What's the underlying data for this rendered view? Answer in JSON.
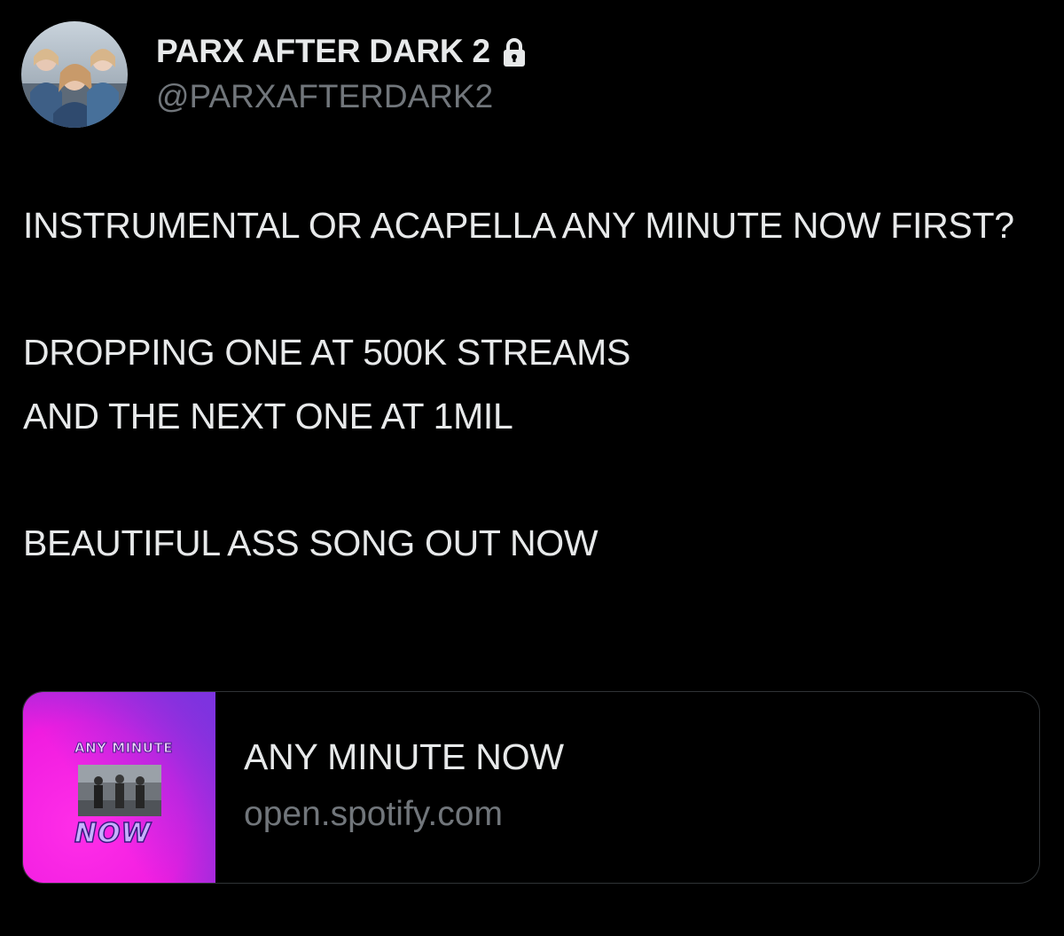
{
  "author": {
    "display_name": "PARX AFTER DARK 2",
    "handle": "@PARXAFTERDARK2",
    "protected_icon": "lock-icon",
    "avatar_icon": "profile-photo"
  },
  "tweet": {
    "paragraphs": [
      "INSTRUMENTAL OR ACAPELLA ANY MINUTE NOW FIRST?",
      "DROPPING ONE AT 500K STREAMS\nAND THE NEXT ONE AT 1MIL",
      "BEAUTIFUL ASS SONG OUT NOW"
    ]
  },
  "link_card": {
    "title": "ANY MINUTE NOW",
    "domain": "open.spotify.com",
    "thumbnail": {
      "top_text": "ANY MINUTE",
      "bottom_text": "NOW"
    }
  },
  "colors": {
    "background": "#000000",
    "primary_text": "#e7e9ea",
    "secondary_text": "#71767b",
    "card_border": "#2f3336",
    "thumb_pink": "#ff1fe0",
    "thumb_purple": "#8a2be2"
  }
}
